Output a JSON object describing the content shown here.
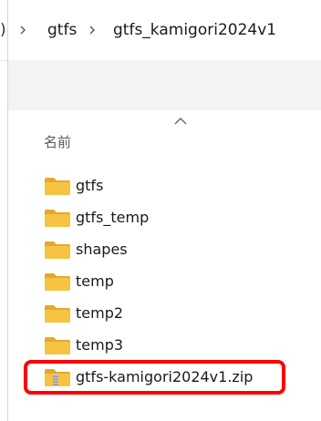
{
  "breadcrumb": {
    "truncated": ")",
    "items": [
      "gtfs",
      "gtfs_kamigori2024v1"
    ]
  },
  "list": {
    "column_header": "名前",
    "items": [
      {
        "label": "gtfs",
        "type": "folder"
      },
      {
        "label": "gtfs_temp",
        "type": "folder"
      },
      {
        "label": "shapes",
        "type": "folder"
      },
      {
        "label": "temp",
        "type": "folder"
      },
      {
        "label": "temp2",
        "type": "folder"
      },
      {
        "label": "temp3",
        "type": "folder"
      },
      {
        "label": "gtfs-kamigori2024v1.zip",
        "type": "zip",
        "highlighted": true
      }
    ]
  },
  "colors": {
    "folder": "#f6c343",
    "folder_dark": "#e3a92a",
    "highlight": "#ff0000",
    "band": "#f3f3f3"
  }
}
